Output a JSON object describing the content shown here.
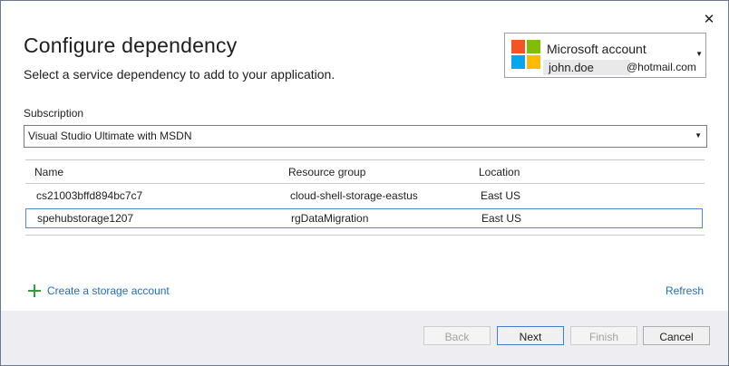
{
  "dialog": {
    "title": "Configure dependency",
    "subtitle": "Select a service dependency to add to your application.",
    "close_glyph": "✕"
  },
  "account": {
    "label": "Microsoft account",
    "user": "john.doe",
    "domain": "@hotmail.com",
    "caret": "▼",
    "logo_colors": [
      "#f35325",
      "#81bc06",
      "#05a6f0",
      "#ffba08"
    ]
  },
  "subscription": {
    "label": "Subscription",
    "value": "Visual Studio Ultimate with MSDN",
    "caret": "▼"
  },
  "table": {
    "columns": [
      "Name",
      "Resource group",
      "Location"
    ],
    "rows": [
      {
        "name": "cs21003bffd894bc7c7",
        "resource_group": "cloud-shell-storage-eastus",
        "location": "East US"
      },
      {
        "name": "spehubstorage1207",
        "resource_group": "rgDataMigration",
        "location": "East US"
      }
    ],
    "selected_index": 1
  },
  "links": {
    "create": "Create a storage account",
    "refresh": "Refresh"
  },
  "footer": {
    "back": "Back",
    "next": "Next",
    "finish": "Finish",
    "cancel": "Cancel"
  },
  "colors": {
    "accent": "#1a6fbf",
    "selection_border": "#4a8ad6",
    "plus_icon": "#2e9e3e"
  }
}
